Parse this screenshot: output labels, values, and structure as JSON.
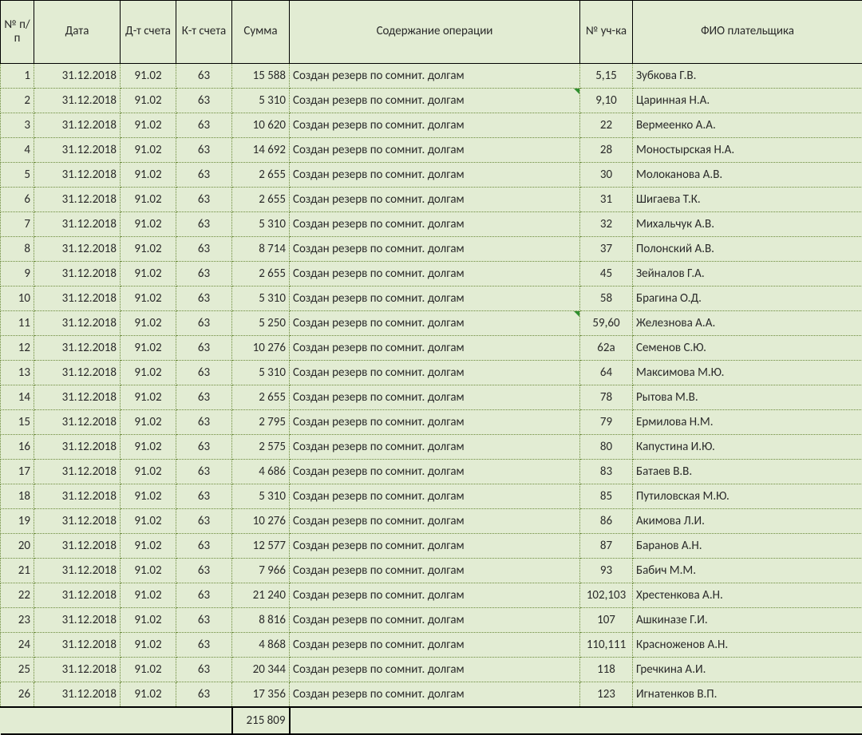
{
  "headers": {
    "num": "№ п/п",
    "date": "Дата",
    "dt": "Д-т счета",
    "kt": "К-т счета",
    "sum": "Сумма",
    "desc": "Содержание операции",
    "plot": "№ уч-ка",
    "fio": "ФИО плательщика"
  },
  "rows": [
    {
      "n": "1",
      "date": "31.12.2018",
      "dt": "91.02",
      "kt": "63",
      "sum": "15 588",
      "desc": "Создан резерв по сомнит. долгам",
      "plot": "5,15",
      "fio": "Зубкова Г.В.",
      "flag": false
    },
    {
      "n": "2",
      "date": "31.12.2018",
      "dt": "91.02",
      "kt": "63",
      "sum": "5 310",
      "desc": "Создан резерв по сомнит. долгам",
      "plot": "9,10",
      "fio": "Царинная Н.А.",
      "flag": true
    },
    {
      "n": "3",
      "date": "31.12.2018",
      "dt": "91.02",
      "kt": "63",
      "sum": "10 620",
      "desc": "Создан резерв по сомнит. долгам",
      "plot": "22",
      "fio": "Вермеенко А.А.",
      "flag": false
    },
    {
      "n": "4",
      "date": "31.12.2018",
      "dt": "91.02",
      "kt": "63",
      "sum": "14 692",
      "desc": "Создан резерв по сомнит. долгам",
      "plot": "28",
      "fio": "Моностырская Н.А.",
      "flag": false
    },
    {
      "n": "5",
      "date": "31.12.2018",
      "dt": "91.02",
      "kt": "63",
      "sum": "2 655",
      "desc": "Создан резерв по сомнит. долгам",
      "plot": "30",
      "fio": "Молоканова А.В.",
      "flag": false
    },
    {
      "n": "6",
      "date": "31.12.2018",
      "dt": "91.02",
      "kt": "63",
      "sum": "2 655",
      "desc": "Создан резерв по сомнит. долгам",
      "plot": "31",
      "fio": "Шигаева Т.К.",
      "flag": false
    },
    {
      "n": "7",
      "date": "31.12.2018",
      "dt": "91.02",
      "kt": "63",
      "sum": "5 310",
      "desc": "Создан резерв по сомнит. долгам",
      "plot": "32",
      "fio": "Михальчук А.В.",
      "flag": false
    },
    {
      "n": "8",
      "date": "31.12.2018",
      "dt": "91.02",
      "kt": "63",
      "sum": "8 714",
      "desc": "Создан резерв по сомнит. долгам",
      "plot": "37",
      "fio": "Полонский А.В.",
      "flag": false
    },
    {
      "n": "9",
      "date": "31.12.2018",
      "dt": "91.02",
      "kt": "63",
      "sum": "2 655",
      "desc": "Создан резерв по сомнит. долгам",
      "plot": "45",
      "fio": "Зейналов Г.А.",
      "flag": false
    },
    {
      "n": "10",
      "date": "31.12.2018",
      "dt": "91.02",
      "kt": "63",
      "sum": "5 310",
      "desc": "Создан резерв по сомнит. долгам",
      "plot": "58",
      "fio": "Брагина О.Д.",
      "flag": false
    },
    {
      "n": "11",
      "date": "31.12.2018",
      "dt": "91.02",
      "kt": "63",
      "sum": "5 250",
      "desc": "Создан резерв по сомнит. долгам",
      "plot": "59,60",
      "fio": "Железнова А.А.",
      "flag": true
    },
    {
      "n": "12",
      "date": "31.12.2018",
      "dt": "91.02",
      "kt": "63",
      "sum": "10 276",
      "desc": "Создан резерв по сомнит. долгам",
      "plot": "62а",
      "fio": "Семенов С.Ю.",
      "flag": false
    },
    {
      "n": "13",
      "date": "31.12.2018",
      "dt": "91.02",
      "kt": "63",
      "sum": "5 310",
      "desc": "Создан резерв по сомнит. долгам",
      "plot": "64",
      "fio": "Максимова М.Ю.",
      "flag": false
    },
    {
      "n": "14",
      "date": "31.12.2018",
      "dt": "91.02",
      "kt": "63",
      "sum": "2 655",
      "desc": "Создан резерв по сомнит. долгам",
      "plot": "78",
      "fio": "Рытова М.В.",
      "flag": false
    },
    {
      "n": "15",
      "date": "31.12.2018",
      "dt": "91.02",
      "kt": "63",
      "sum": "2 795",
      "desc": "Создан резерв по сомнит. долгам",
      "plot": "79",
      "fio": "Ермилова Н.М.",
      "flag": false
    },
    {
      "n": "16",
      "date": "31.12.2018",
      "dt": "91.02",
      "kt": "63",
      "sum": "2 575",
      "desc": "Создан резерв по сомнит. долгам",
      "plot": "80",
      "fio": "Капустина И.Ю.",
      "flag": false
    },
    {
      "n": "17",
      "date": "31.12.2018",
      "dt": "91.02",
      "kt": "63",
      "sum": "4 686",
      "desc": "Создан резерв по сомнит. долгам",
      "plot": "83",
      "fio": "Батаев В.В.",
      "flag": false
    },
    {
      "n": "18",
      "date": "31.12.2018",
      "dt": "91.02",
      "kt": "63",
      "sum": "5 310",
      "desc": "Создан резерв по сомнит. долгам",
      "plot": "85",
      "fio": "Путиловская М.Ю.",
      "flag": false
    },
    {
      "n": "19",
      "date": "31.12.2018",
      "dt": "91.02",
      "kt": "63",
      "sum": "10 276",
      "desc": "Создан резерв по сомнит. долгам",
      "plot": "86",
      "fio": "Акимова Л.И.",
      "flag": false
    },
    {
      "n": "20",
      "date": "31.12.2018",
      "dt": "91.02",
      "kt": "63",
      "sum": "12 577",
      "desc": "Создан резерв по сомнит. долгам",
      "plot": "87",
      "fio": "Баранов А.Н.",
      "flag": false
    },
    {
      "n": "21",
      "date": "31.12.2018",
      "dt": "91.02",
      "kt": "63",
      "sum": "7 966",
      "desc": "Создан резерв по сомнит. долгам",
      "plot": "93",
      "fio": "Бабич М.М.",
      "flag": false
    },
    {
      "n": "22",
      "date": "31.12.2018",
      "dt": "91.02",
      "kt": "63",
      "sum": "21 240",
      "desc": "Создан резерв по сомнит. долгам",
      "plot": "102,103",
      "fio": "Хрестенкова А.Н.",
      "flag": false
    },
    {
      "n": "23",
      "date": "31.12.2018",
      "dt": "91.02",
      "kt": "63",
      "sum": "8 816",
      "desc": "Создан резерв по сомнит. долгам",
      "plot": "107",
      "fio": "Ашкиназе Г.И.",
      "flag": false
    },
    {
      "n": "24",
      "date": "31.12.2018",
      "dt": "91.02",
      "kt": "63",
      "sum": "4 868",
      "desc": "Создан резерв по сомнит. долгам",
      "plot": "110,111",
      "fio": "Красноженов А.Н.",
      "flag": false
    },
    {
      "n": "25",
      "date": "31.12.2018",
      "dt": "91.02",
      "kt": "63",
      "sum": "20 344",
      "desc": "Создан резерв по сомнит. долгам",
      "plot": "118",
      "fio": "Гречкина А.И.",
      "flag": false
    },
    {
      "n": "26",
      "date": "31.12.2018",
      "dt": "91.02",
      "kt": "63",
      "sum": "17 356",
      "desc": "Создан резерв по сомнит. долгам",
      "plot": "123",
      "fio": "Игнатенков В.П.",
      "flag": false
    }
  ],
  "total": "215 809"
}
